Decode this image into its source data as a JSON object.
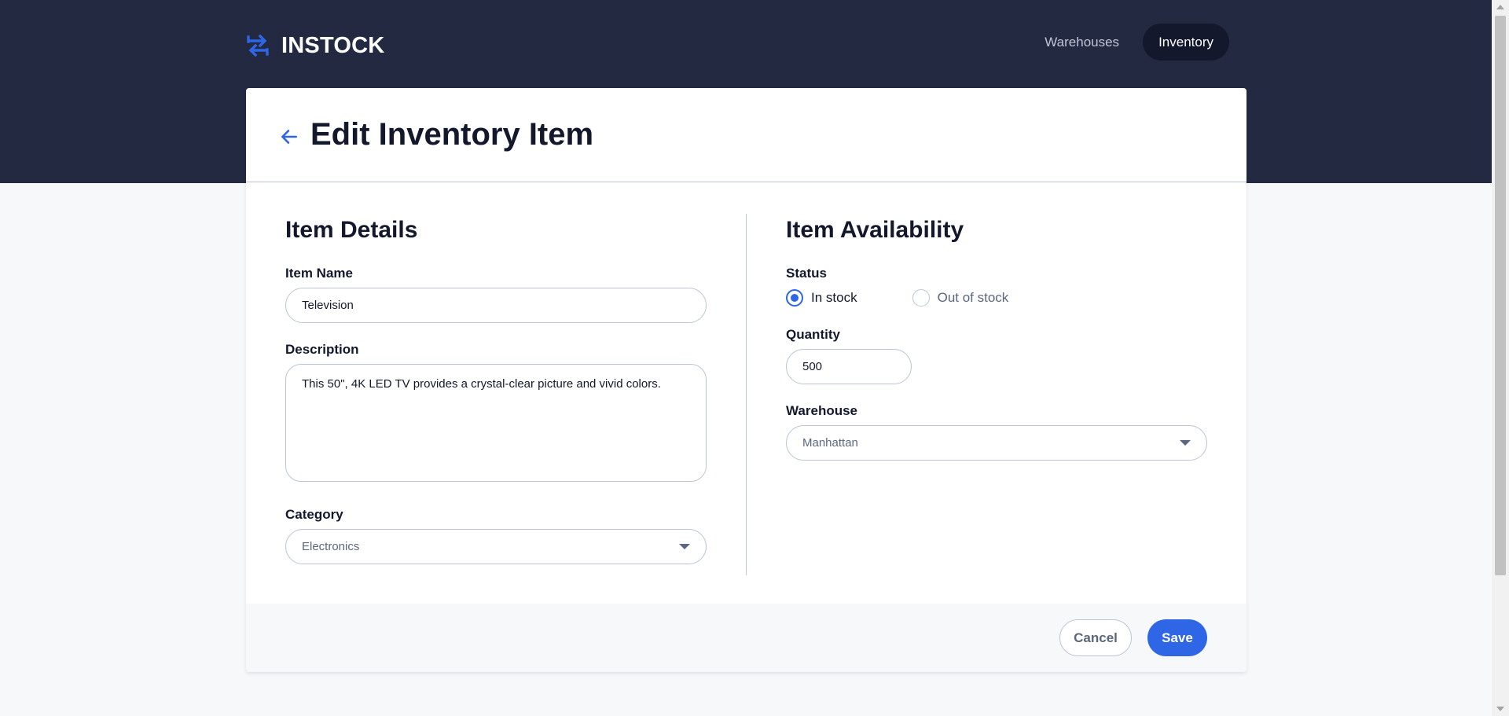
{
  "header": {
    "logo_text": "INSTOCK",
    "nav": [
      {
        "label": "Warehouses",
        "active": false
      },
      {
        "label": "Inventory",
        "active": true
      }
    ]
  },
  "page": {
    "title": "Edit Inventory Item",
    "back_icon": "arrow-left-icon"
  },
  "item_details": {
    "section_title": "Item Details",
    "item_name_label": "Item Name",
    "item_name_value": "Television",
    "description_label": "Description",
    "description_value": "This 50\", 4K LED TV provides a crystal-clear picture and vivid colors.",
    "category_label": "Category",
    "category_value": "Electronics"
  },
  "item_availability": {
    "section_title": "Item Availability",
    "status_label": "Status",
    "status_options": [
      {
        "label": "In stock",
        "checked": true
      },
      {
        "label": "Out of stock",
        "checked": false
      }
    ],
    "quantity_label": "Quantity",
    "quantity_value": "500",
    "warehouse_label": "Warehouse",
    "warehouse_value": "Manhattan"
  },
  "footer": {
    "cancel_label": "Cancel",
    "save_label": "Save"
  },
  "colors": {
    "header_bg": "#232940",
    "accent": "#2E66E6",
    "page_bg": "#F7F8FA",
    "border": "#BDC5D5"
  }
}
